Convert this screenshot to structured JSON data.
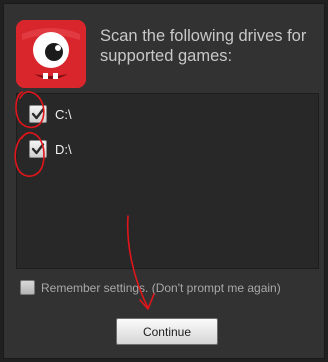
{
  "dialog": {
    "heading": "Scan the following drives for supported games:",
    "app_icon": "red-one-eyed-monster-icon"
  },
  "drives": [
    {
      "label": "C:\\",
      "checked": true
    },
    {
      "label": "D:\\",
      "checked": true
    }
  ],
  "remember": {
    "label": "Remember settings. (Don't prompt me again)",
    "checked": false
  },
  "continue_button": {
    "label": "Continue"
  },
  "colors": {
    "background": "#202020",
    "dialog": "#323232",
    "list": "#282828",
    "annotation": "#e0151b",
    "icon_red": "#d9262d"
  }
}
